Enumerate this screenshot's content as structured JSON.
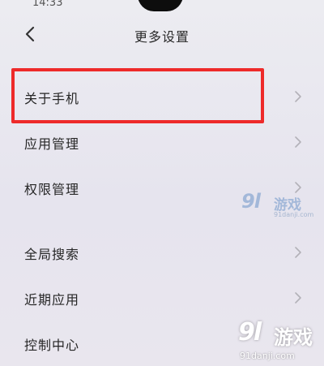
{
  "status_bar": {
    "time": "14:33"
  },
  "header": {
    "title": "更多设置",
    "back_icon": "chevron-left-icon"
  },
  "settings": {
    "items": [
      {
        "label": "关于手机",
        "icon": "chevron-right-icon"
      },
      {
        "label": "应用管理",
        "icon": "chevron-right-icon"
      },
      {
        "label": "权限管理",
        "icon": "chevron-right-icon"
      },
      {
        "label": "全局搜索",
        "icon": "chevron-right-icon"
      },
      {
        "label": "近期应用",
        "icon": "chevron-right-icon"
      },
      {
        "label": "控制中心",
        "icon": "chevron-right-icon"
      }
    ]
  },
  "highlight": {
    "color": "#ee2a2a",
    "target": "关于手机"
  },
  "watermark": {
    "logo": "9l",
    "name": "游戏",
    "url": "91danji.com"
  }
}
